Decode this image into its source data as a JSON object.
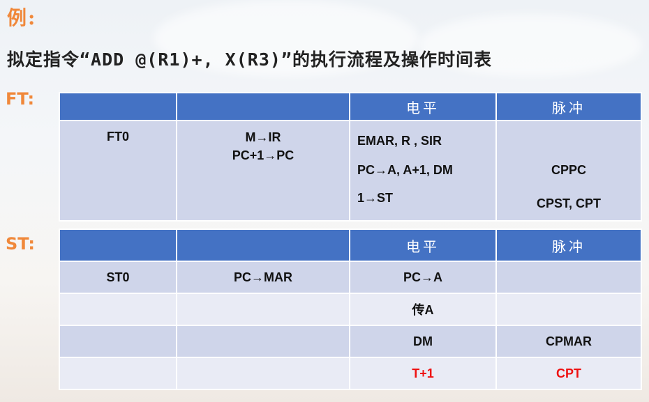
{
  "example_label": "例:",
  "main_title": "拟定指令“ADD  @(R1)+, X(R3)”的执行流程及操作时间表",
  "ft": {
    "label": "FT:",
    "headers": [
      "",
      "",
      "电平",
      "脉冲"
    ],
    "row": {
      "name": "FT0",
      "ops": [
        "M→IR",
        "PC+1→PC"
      ],
      "levels": [
        "EMAR, R , SIR",
        "PC→A, A+1, DM",
        "1→ST"
      ],
      "pulses": [
        "CPPC",
        "CPST, CPT"
      ]
    }
  },
  "st": {
    "label": "ST:",
    "headers": [
      "",
      "",
      "电平",
      "脉冲"
    ],
    "rows": [
      {
        "name": "ST0",
        "op": "PC→MAR",
        "level": "PC→A",
        "pulse": ""
      },
      {
        "name": "",
        "op": "",
        "level": "传A",
        "pulse": ""
      },
      {
        "name": "",
        "op": "",
        "level": "DM",
        "pulse": "CPMAR"
      },
      {
        "name": "",
        "op": "",
        "level": "T+1",
        "pulse": "CPT"
      }
    ]
  },
  "colors": {
    "accent": "#f0883a",
    "header": "#4472c4",
    "row_dark": "#cfd5ea",
    "row_light": "#e9ebf5",
    "highlight": "#ee1111"
  }
}
